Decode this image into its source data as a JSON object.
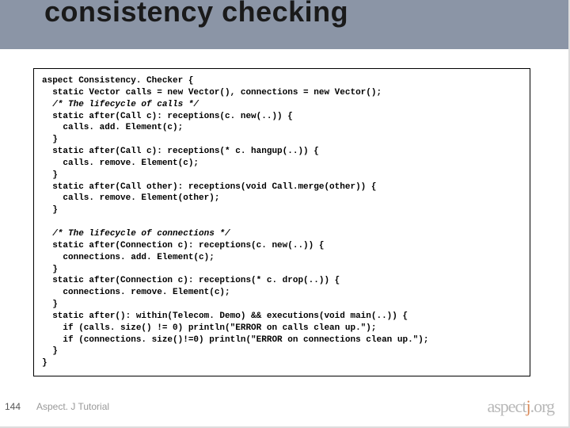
{
  "slide": {
    "title": "consistency checking",
    "number": "144",
    "footer": "Aspect. J Tutorial",
    "logo_text": "aspect",
    "logo_j": "j",
    "logo_suffix": ".org"
  },
  "code": {
    "l01": "aspect Consistency. Checker {",
    "l02": "  static Vector calls = new Vector(), connections = new Vector();",
    "l03": "  /* The lifecycle of calls */",
    "l04": "  static after(Call c): receptions(c. new(..)) {",
    "l05": "    calls. add. Element(c);",
    "l06": "  }",
    "l07": "  static after(Call c): receptions(* c. hangup(..)) {",
    "l08": "    calls. remove. Element(c);",
    "l09": "  }",
    "l10": "  static after(Call other): receptions(void Call.merge(other)) {",
    "l11": "    calls. remove. Element(other);",
    "l12": "  }",
    "l13": "",
    "l14": "  /* The lifecycle of connections */",
    "l15": "  static after(Connection c): receptions(c. new(..)) {",
    "l16": "    connections. add. Element(c);",
    "l17": "  }",
    "l18": "  static after(Connection c): receptions(* c. drop(..)) {",
    "l19": "    connections. remove. Element(c);",
    "l20": "  }",
    "l21": "  static after(): within(Telecom. Demo) && executions(void main(..)) {",
    "l22": "    if (calls. size() != 0) println(\"ERROR on calls clean up.\");",
    "l23": "    if (connections. size()!=0) println(\"ERROR on connections clean up.\");",
    "l24": "  }",
    "l25": "}"
  }
}
